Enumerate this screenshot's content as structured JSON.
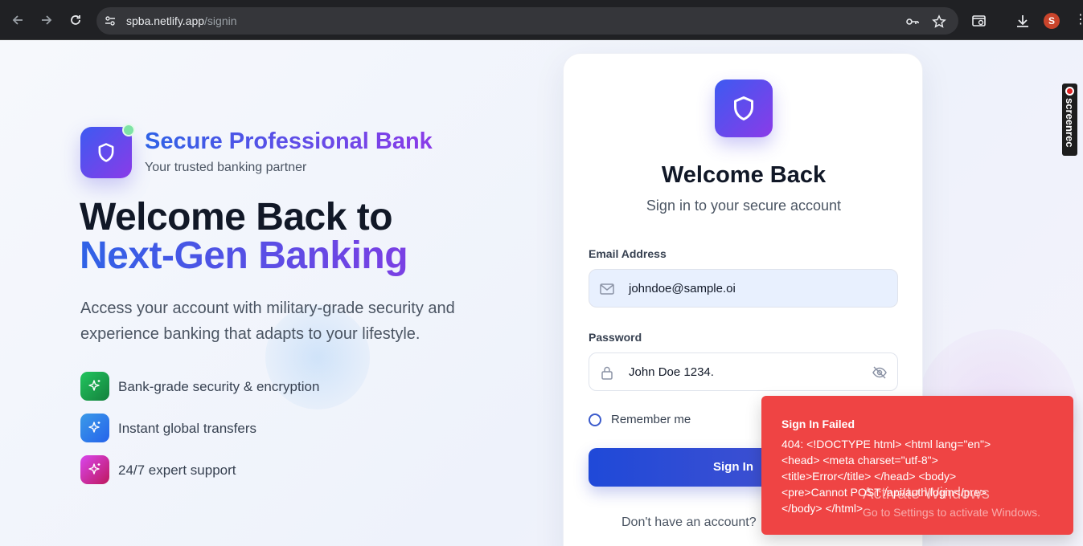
{
  "browser": {
    "url_host": "spba.netlify.app",
    "url_path": "/signin",
    "profile_initial": "S",
    "icons": [
      "back-icon",
      "forward-icon",
      "reload-icon",
      "site-settings-icon",
      "password-key-icon",
      "bookmark-star-icon",
      "tab-search-icon",
      "download-icon",
      "more-icon"
    ]
  },
  "brand": {
    "name": "Secure Professional Bank",
    "tagline": "Your trusted banking partner"
  },
  "hero": {
    "line1": "Welcome Back to",
    "line2": "Next-Gen Banking",
    "description": "Access your account with military-grade security and experience banking that adapts to your lifestyle."
  },
  "features": [
    {
      "label": "Bank-grade security & encryption",
      "color": "#16a34a"
    },
    {
      "label": "Instant global transfers",
      "color": "#2f7fe0"
    },
    {
      "label": "24/7 expert support",
      "color": "#d03ab8"
    }
  ],
  "card": {
    "title": "Welcome Back",
    "subtitle": "Sign in to your secure account",
    "email_label": "Email Address",
    "email_value": "johndoe@sample.oi",
    "password_label": "Password",
    "password_value": "John Doe 1234.",
    "remember_label": "Remember me",
    "signin_label": "Sign In",
    "no_account": "Don't have an account?"
  },
  "toast": {
    "title": "Sign In Failed",
    "body": "404: <!DOCTYPE html> <html lang=\"en\"> <head> <meta charset=\"utf-8\"> <title>Error</title> </head> <body> <pre>Cannot POST /api/auth/login</pre> </body> </html>",
    "color": "#ef4444"
  },
  "watermark": {
    "line1": "Activate Windows",
    "line2": "Go to Settings to activate Windows."
  },
  "screenrec": {
    "label": "screenrec"
  },
  "colors": {
    "accent_start": "#3d5af1",
    "accent_end": "#8a3be8",
    "email_field_bg": "#e8f0fe"
  }
}
